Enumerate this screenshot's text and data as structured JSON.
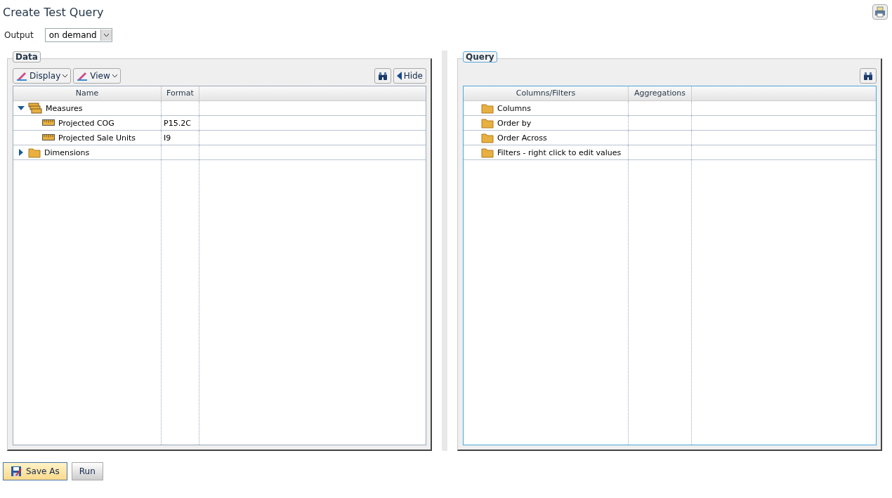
{
  "title": "Create Test Query",
  "output": {
    "label": "Output",
    "value": "on demand"
  },
  "data_panel": {
    "legend": "Data",
    "toolbar": [
      {
        "kind": "menu",
        "label": "Display"
      },
      {
        "kind": "menu",
        "label": "View"
      }
    ],
    "hide_label": "Hide",
    "columns": [
      "Name",
      "Format"
    ],
    "tree": [
      {
        "kind": "group",
        "name": "Measures",
        "expanded": true,
        "children": [
          {
            "kind": "measure",
            "name": "Projected COG",
            "format": "P15.2C"
          },
          {
            "kind": "measure",
            "name": "Projected Sale Units",
            "format": "I9"
          }
        ]
      },
      {
        "kind": "folder",
        "name": "Dimensions",
        "expanded": false
      }
    ]
  },
  "query_panel": {
    "legend": "Query",
    "columns": [
      "Columns/Filters",
      "Aggregations"
    ],
    "rows": [
      {
        "name": "Columns"
      },
      {
        "name": "Order by"
      },
      {
        "name": "Order Across"
      },
      {
        "name": "Filters - right click to edit values"
      }
    ]
  },
  "buttons": [
    {
      "kind": "save",
      "label": "Save As"
    },
    {
      "kind": "plain",
      "label": "Run"
    }
  ]
}
